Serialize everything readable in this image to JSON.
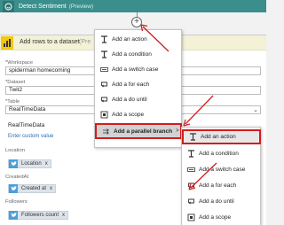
{
  "sentiment_card": {
    "title": "Detect Sentiment",
    "preview": "(Preview)"
  },
  "plus_label": "+",
  "card": {
    "title": "Add rows to a dataset",
    "preview": "(Pre",
    "fields": {
      "workspace": {
        "label": "*Workspace",
        "value": "spiderman homecoming"
      },
      "dataset": {
        "label": "*Dataset",
        "value": "Twit2"
      },
      "table": {
        "label": "*Table",
        "value": "RealTimeData",
        "option": "RealTimeData",
        "custom_link": "Enter custom value"
      },
      "location": {
        "label": "Location",
        "token": "Location",
        "remove": "x"
      },
      "createdat": {
        "label": "CreatedAt",
        "token": "Created at",
        "remove": "x"
      },
      "followers": {
        "label": "Followers",
        "token": "Followers count",
        "remove": "x"
      }
    }
  },
  "menu": {
    "items": [
      "Add an action",
      "Add a condition",
      "Add a switch case",
      "Add a for each",
      "Add a do until",
      "Add a scope"
    ],
    "parallel": "Add a parallel branch",
    "parallel_arrow": ">"
  },
  "submenu": {
    "items": [
      "Add an action",
      "Add a condition",
      "Add a switch case",
      "Add a for each",
      "Add a do until",
      "Add a scope"
    ]
  },
  "colors": {
    "teal": "#3a8f8c",
    "highlight_red": "#d01f1f",
    "powerbi_yellow": "#f2c811",
    "twitter_blue": "#4a9fdc"
  }
}
